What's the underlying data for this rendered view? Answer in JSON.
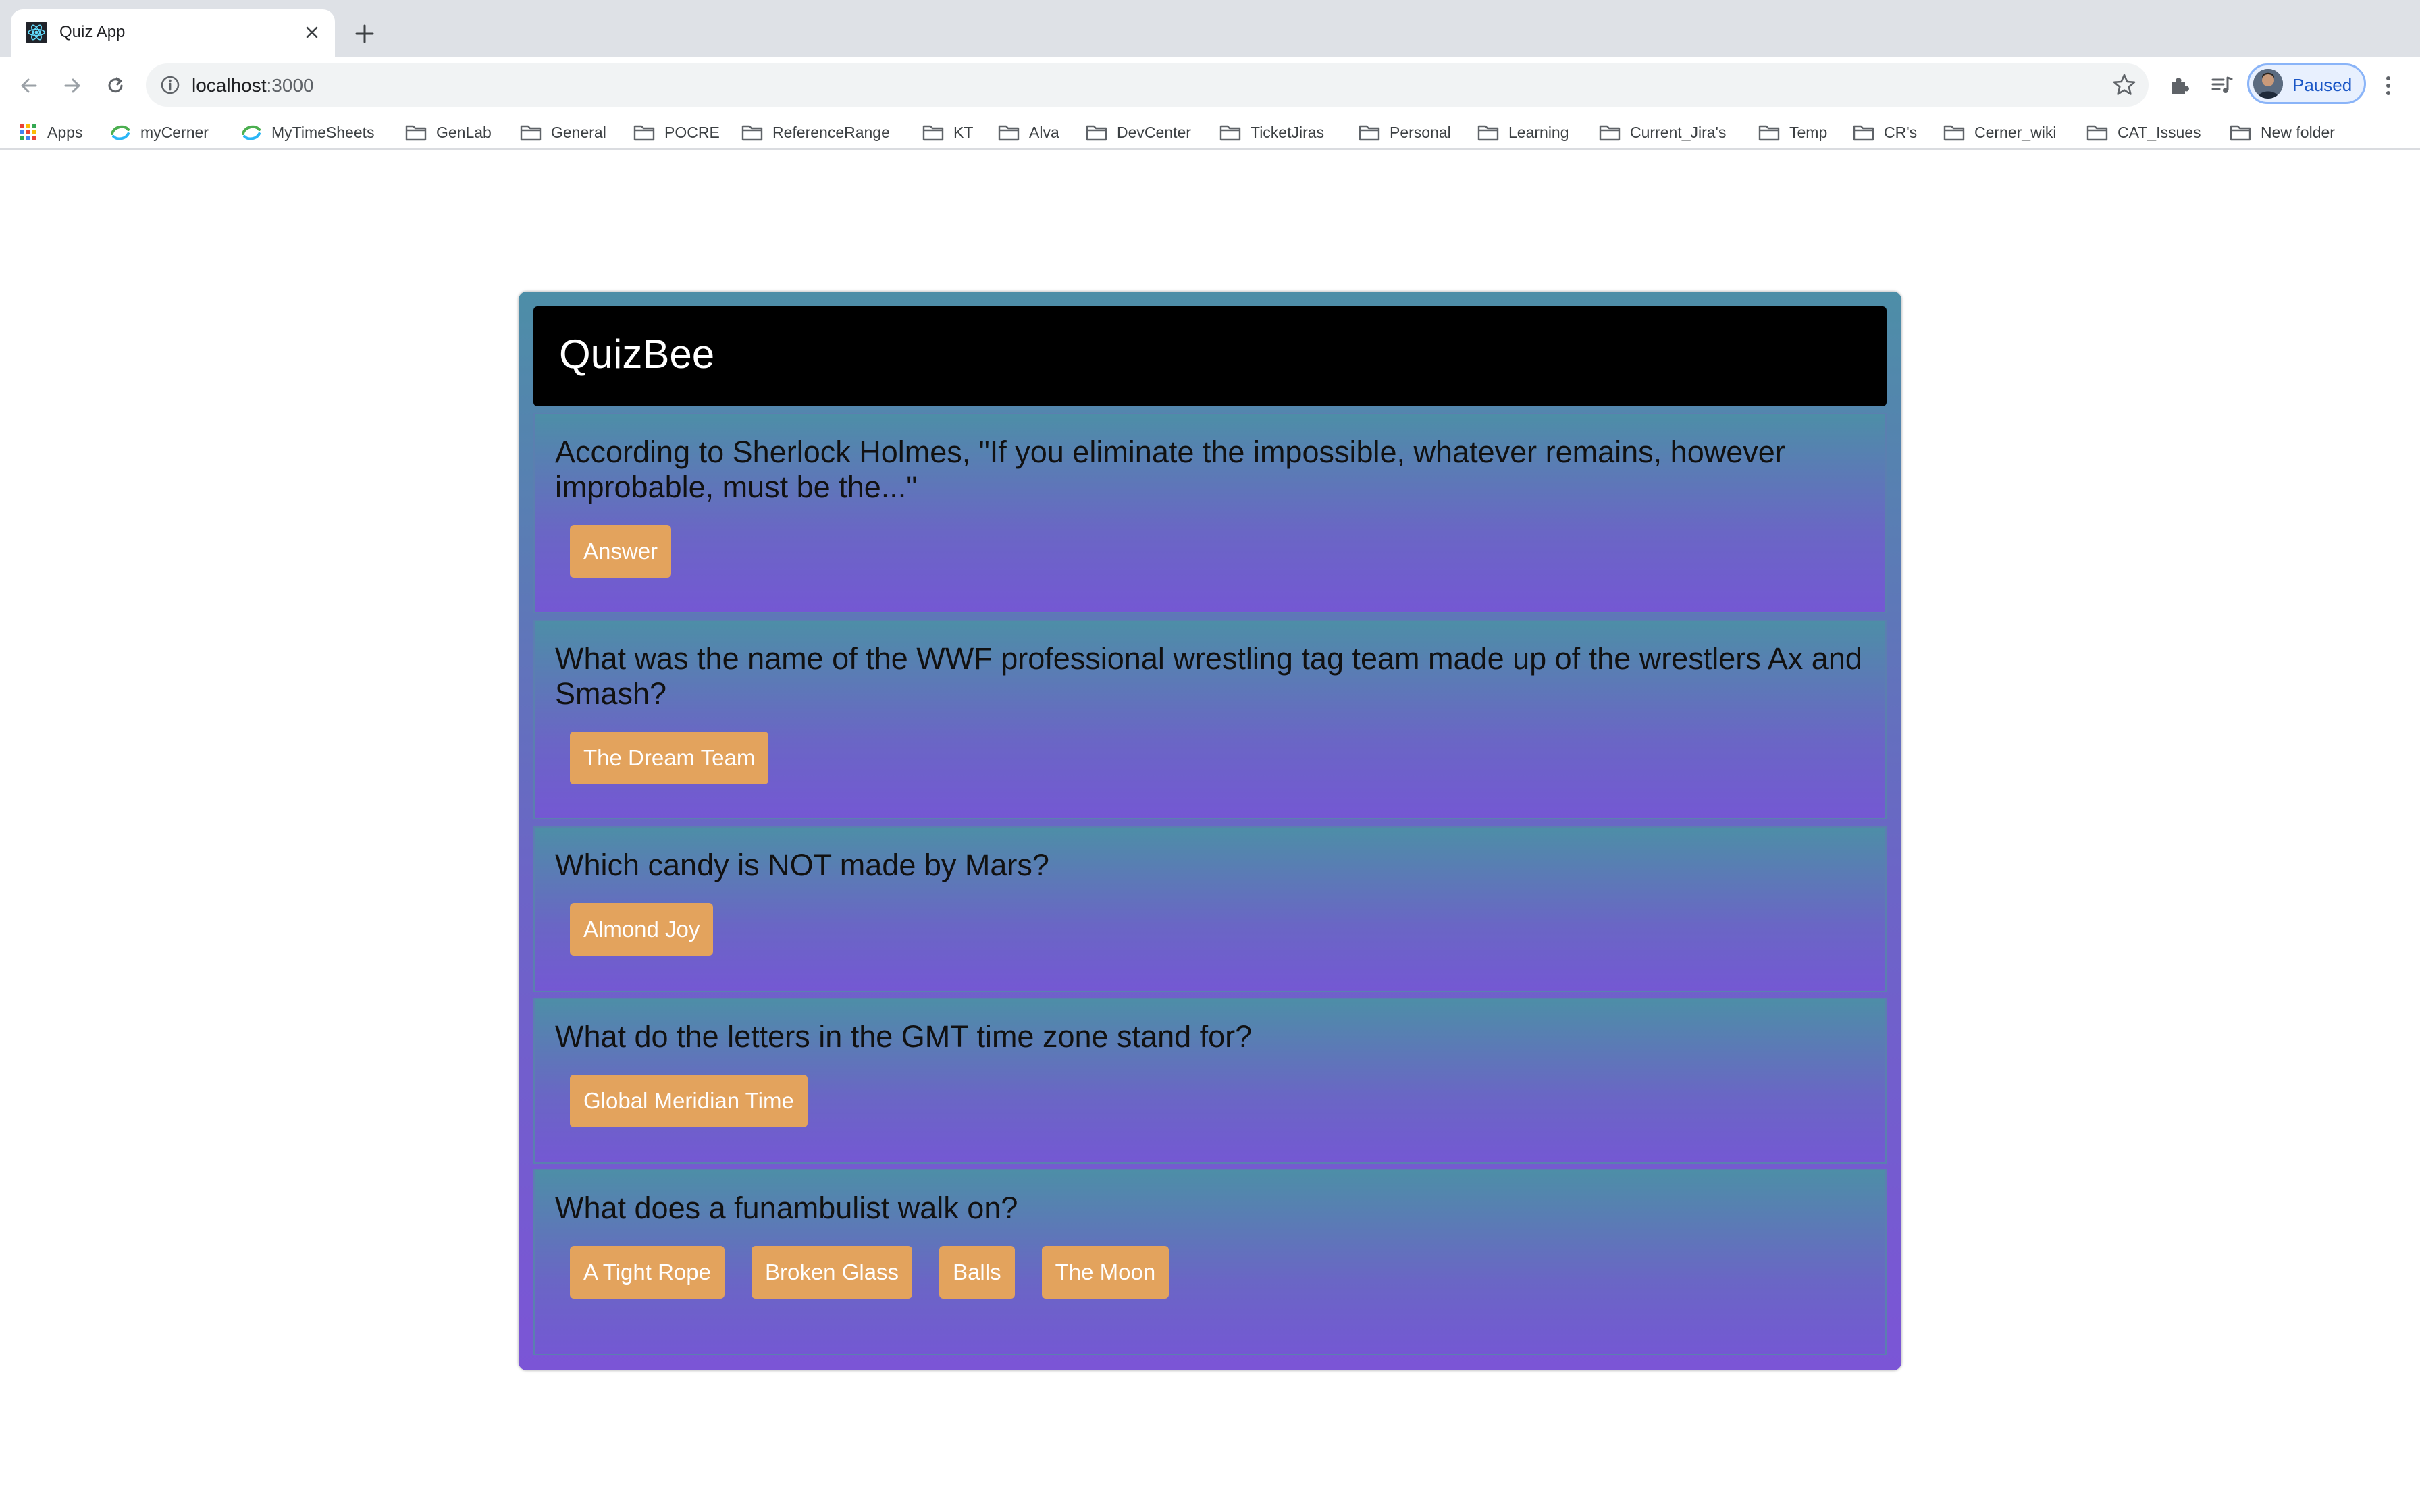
{
  "browser": {
    "tab_title": "Quiz App",
    "url_host": "localhost",
    "url_port": ":3000",
    "profile_label": "Paused",
    "bookmarks": [
      {
        "label": "Apps",
        "icon": "apps-grid-icon"
      },
      {
        "label": "myCerner",
        "icon": "site-icon"
      },
      {
        "label": "MyTimeSheets",
        "icon": "site-icon"
      },
      {
        "label": "GenLab",
        "icon": "folder-icon"
      },
      {
        "label": "General",
        "icon": "folder-icon"
      },
      {
        "label": "POCRE",
        "icon": "folder-icon"
      },
      {
        "label": "ReferenceRange",
        "icon": "folder-icon"
      },
      {
        "label": "KT",
        "icon": "folder-icon"
      },
      {
        "label": "Alva",
        "icon": "folder-icon"
      },
      {
        "label": "DevCenter",
        "icon": "folder-icon"
      },
      {
        "label": "TicketJiras",
        "icon": "folder-icon"
      },
      {
        "label": "Personal",
        "icon": "folder-icon"
      },
      {
        "label": "Learning",
        "icon": "folder-icon"
      },
      {
        "label": "Current_Jira's",
        "icon": "folder-icon"
      },
      {
        "label": "Temp",
        "icon": "folder-icon"
      },
      {
        "label": "CR's",
        "icon": "folder-icon"
      },
      {
        "label": "Cerner_wiki",
        "icon": "folder-icon"
      },
      {
        "label": "CAT_Issues",
        "icon": "folder-icon"
      },
      {
        "label": "New folder",
        "icon": "folder-icon"
      }
    ]
  },
  "app": {
    "title": "QuizBee",
    "colors": {
      "header_bg": "#000000",
      "answer_button": "#e3a35d",
      "gradient_top": "#4d8ea7",
      "gradient_bottom": "#7b55d6"
    },
    "questions": [
      {
        "text": "According to Sherlock Holmes, \"If you eliminate the impossible, whatever remains, however improbable, must be the...\"",
        "answers": [
          "Answer"
        ]
      },
      {
        "text": "What was the name of the WWF professional wrestling tag team made up of the wrestlers Ax and Smash?",
        "answers": [
          "The Dream Team"
        ]
      },
      {
        "text": "Which candy is NOT made by Mars?",
        "answers": [
          "Almond Joy"
        ]
      },
      {
        "text": "What do the letters in the GMT time zone stand for?",
        "answers": [
          "Global Meridian Time"
        ]
      },
      {
        "text": "What does a funambulist walk on?",
        "answers": [
          "A Tight Rope",
          "Broken Glass",
          "Balls",
          "The Moon"
        ]
      }
    ]
  }
}
